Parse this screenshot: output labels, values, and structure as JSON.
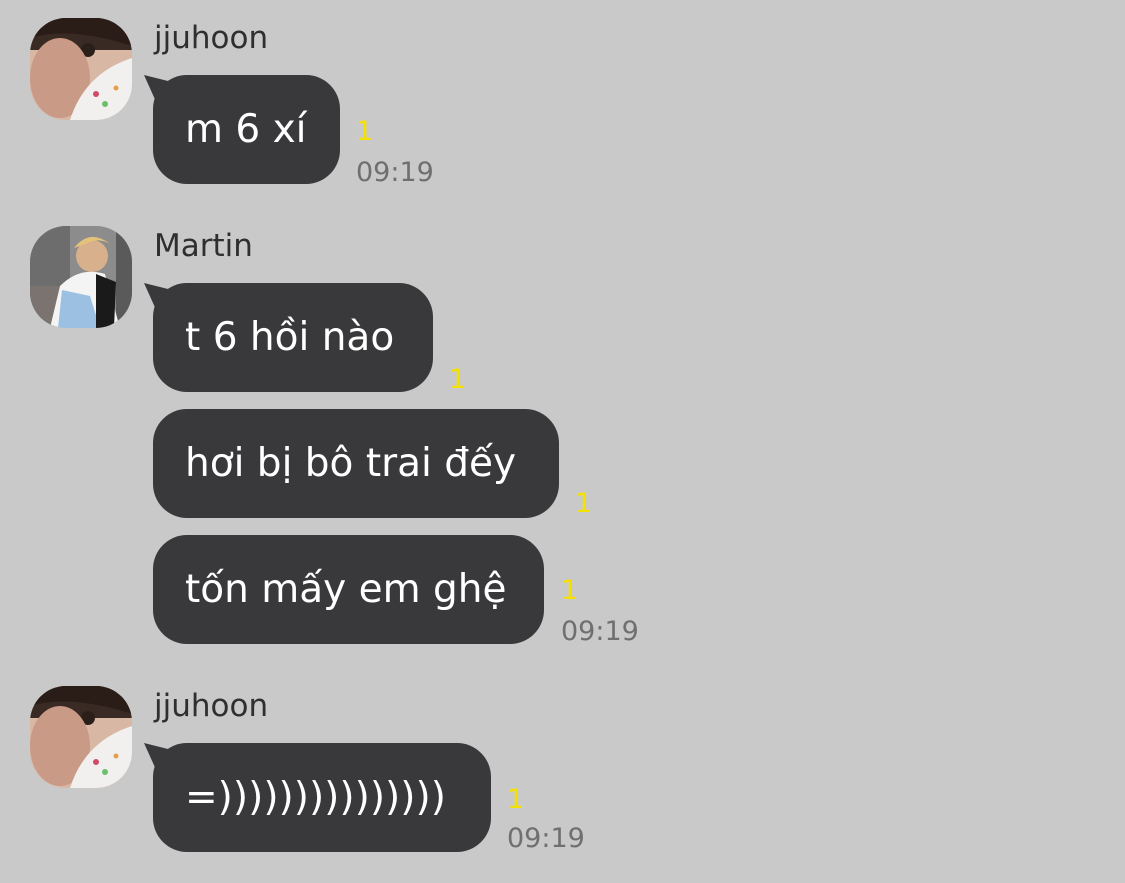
{
  "groups": [
    {
      "sender": "jjuhoon",
      "avatar": "jjuhoon-avatar",
      "messages": [
        {
          "text": "m 6 xí",
          "read": "1"
        }
      ],
      "time": "09:19"
    },
    {
      "sender": "Martin",
      "avatar": "martin-avatar",
      "messages": [
        {
          "text": "t 6 hồi nào",
          "read": "1"
        },
        {
          "text": "hơi bị bô trai đếy",
          "read": "1"
        },
        {
          "text": "tốn mấy em ghệ",
          "read": "1"
        }
      ],
      "time": "09:19"
    },
    {
      "sender": "jjuhoon",
      "avatar": "jjuhoon-avatar",
      "messages": [
        {
          "text": "=)))))))))))))))",
          "read": "1"
        }
      ],
      "time": "09:19"
    }
  ],
  "colors": {
    "background": "#c9c9c9",
    "bubble": "#39393b",
    "bubble_text": "#ffffff",
    "read_count": "#f5e100",
    "timestamp": "#6f6f6f"
  }
}
